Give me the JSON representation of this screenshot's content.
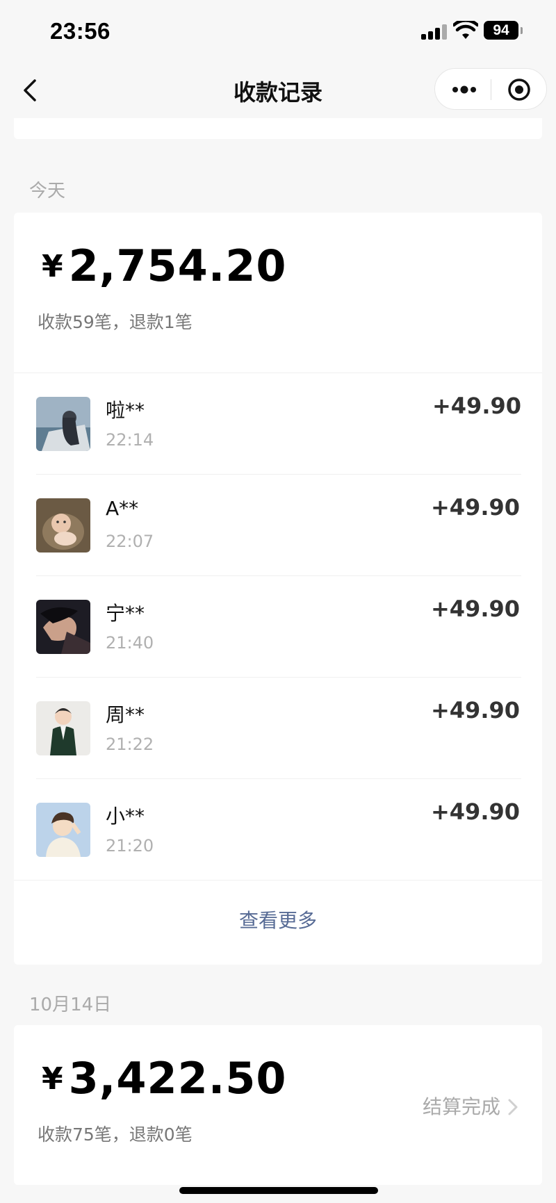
{
  "status_bar": {
    "time": "23:56",
    "battery": "94"
  },
  "nav": {
    "title": "收款记录"
  },
  "today": {
    "label": "今天",
    "currency": "¥",
    "amount": "2,754.20",
    "summary": "收款59笔，退款1笔",
    "records": [
      {
        "name": "啦**",
        "time": "22:14",
        "amount": "+49.90"
      },
      {
        "name": "A**",
        "time": "22:07",
        "amount": "+49.90"
      },
      {
        "name": "宁**",
        "time": "21:40",
        "amount": "+49.90"
      },
      {
        "name": "周**",
        "time": "21:22",
        "amount": "+49.90"
      },
      {
        "name": "小**",
        "time": "21:20",
        "amount": "+49.90"
      }
    ],
    "more_label": "查看更多"
  },
  "day2": {
    "label": "10月14日",
    "currency": "¥",
    "amount": "3,422.50",
    "summary": "收款75笔，退款0笔",
    "status": "结算完成"
  },
  "colors": {
    "link": "#576b95",
    "background": "#f7f7f7"
  }
}
